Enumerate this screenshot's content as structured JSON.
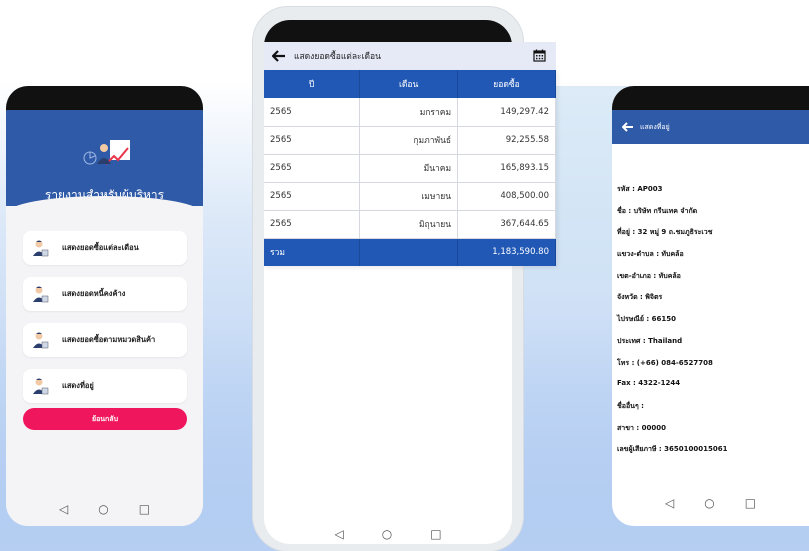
{
  "left_screen": {
    "hero_title": "รายงานสำหรับผู้บริหาร",
    "menu_items": [
      {
        "label": "แสดงยอดซื้อแต่ละเดือน",
        "icon": "user-report-icon"
      },
      {
        "label": "แสดงยอดหนี้คงค้าง",
        "icon": "user-report-icon"
      },
      {
        "label": "แสดงยอดซื้อตามหมวดสินค้า",
        "icon": "user-report-icon"
      },
      {
        "label": "แสดงที่อยู่",
        "icon": "user-report-icon"
      }
    ],
    "back_button": "ย้อนกลับ"
  },
  "center_screen": {
    "header_title": "แสดงยอดซื้อแต่ละเดือน",
    "table": {
      "headers": [
        "ปี",
        "เดือน",
        "ยอดซื้อ"
      ],
      "rows": [
        [
          "2565",
          "มกราคม",
          "149,297.42"
        ],
        [
          "2565",
          "กุมภาพันธ์",
          "92,255.58"
        ],
        [
          "2565",
          "มีนาคม",
          "165,893.15"
        ],
        [
          "2565",
          "เมษายน",
          "408,500.00"
        ],
        [
          "2565",
          "มิถุนายน",
          "367,644.65"
        ]
      ],
      "total_label": "รวม",
      "total_value": "1,183,590.80"
    }
  },
  "right_screen": {
    "header_title": "แสดงที่อยู่",
    "lines": [
      "รหัส : AP003",
      "ชื่อ : บริษัท กรีนเทค จำกัด",
      "ที่อยู่ : 32 หมู่ 9 ถ.ชมภูธิระเวช",
      "แขวง-ตำบล : ทับคล้อ",
      "เขต-อำเภอ : ทับคล้อ",
      "จังหวัด : พิจิตร",
      "ไปรษณีย์ : 66150",
      "ประเทศ : Thailand",
      "โทร : (+66) 084-6527708",
      "Fax : 4322-1244",
      "ชื่ออื่นๆ :",
      "สาขา : 00000",
      "เลขผู้เสียภาษี : 3650100015061"
    ]
  },
  "nav": {
    "back": "◁",
    "home": "○",
    "recent": "□"
  },
  "colors": {
    "primary": "#2158b5",
    "header_blue": "#2f5aa8",
    "accent_pink": "#f0165e"
  }
}
